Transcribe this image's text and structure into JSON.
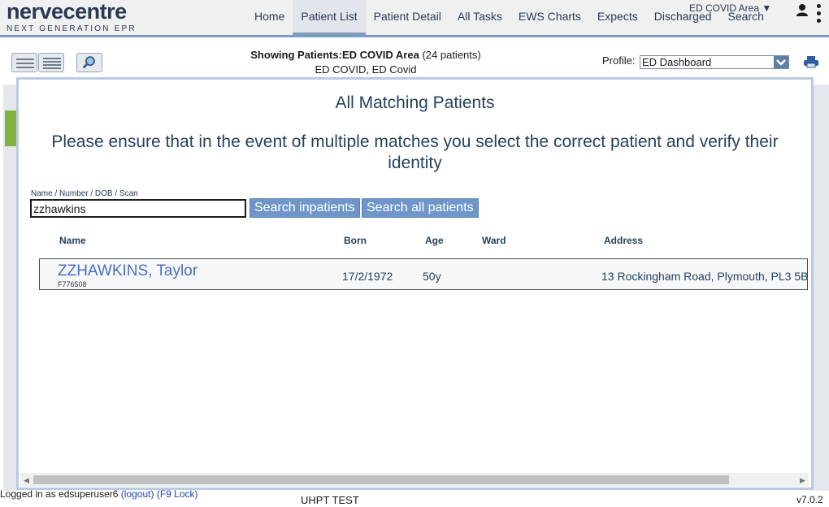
{
  "brand": {
    "name": "nervecentre",
    "tagline": "NEXT GENERATION EPR"
  },
  "nav": {
    "items": [
      {
        "label": "Home"
      },
      {
        "label": "Patient List",
        "active": true
      },
      {
        "label": "Patient Detail"
      },
      {
        "label": "All Tasks"
      },
      {
        "label": "EWS Charts"
      },
      {
        "label": "Expects"
      },
      {
        "label": "Discharged"
      },
      {
        "label": "Search"
      }
    ],
    "area": "ED COVID Area ▼"
  },
  "toolbar": {
    "showing_prefix": "Showing Patients:",
    "showing_area": "ED COVID Area",
    "showing_count": "(24 patients)",
    "showing_sub": "ED COVID, ED Covid",
    "profile_label": "Profile:",
    "profile_value": "ED Dashboard"
  },
  "modal": {
    "title": "All Matching Patients",
    "warning": "Please ensure that in the event of multiple matches you select the correct patient and verify their identity",
    "search_label": "Name / Number / DOB / Scan",
    "search_value": "zzhawkins",
    "btn_inpatients": "Search inpatients",
    "btn_all": "Search all patients",
    "columns": {
      "name": "Name",
      "born": "Born",
      "age": "Age",
      "ward": "Ward",
      "address": "Address"
    },
    "results": [
      {
        "name": "ZZHAWKINS, Taylor",
        "number": "F776508",
        "born": "17/2/1972",
        "age": "50y",
        "ward": "",
        "address": "13 Rockingham Road, Plymouth, PL3 5B"
      }
    ]
  },
  "footer": {
    "logged_in": "Logged in as edsuperuser6",
    "logout": "(logout)",
    "lock": "(F9 Lock)",
    "env": "UHPT TEST",
    "version": "v7.0.2"
  },
  "colors": {
    "accent": "#6f96c8",
    "nav_text": "#2a3a55",
    "link": "#4a6fbf"
  }
}
